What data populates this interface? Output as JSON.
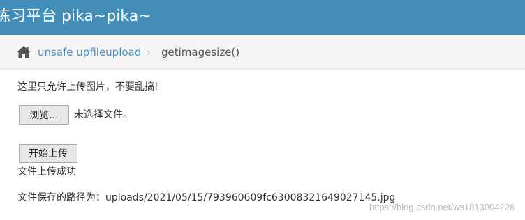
{
  "header": {
    "title": "练习平台 pika~pika~"
  },
  "breadcrumb": {
    "link": "unsafe upfileupload",
    "separator": "›",
    "current": "getimagesize()"
  },
  "form": {
    "hint": "这里只允许上传图片，不要乱搞!",
    "browse_label": "浏览...",
    "no_file": "未选择文件。",
    "upload_label": "开始上传"
  },
  "result": {
    "success": "文件上传成功",
    "path_label": "文件保存的路径为：",
    "path_value": "uploads/2021/05/15/793960609fc63008321649027145.jpg"
  },
  "watermark": "https://blog.csdn.net/ws1813004226",
  "colors": {
    "header_bg": "#438eb9",
    "link": "#4c8fbd"
  },
  "icons": [
    "home-icon"
  ]
}
